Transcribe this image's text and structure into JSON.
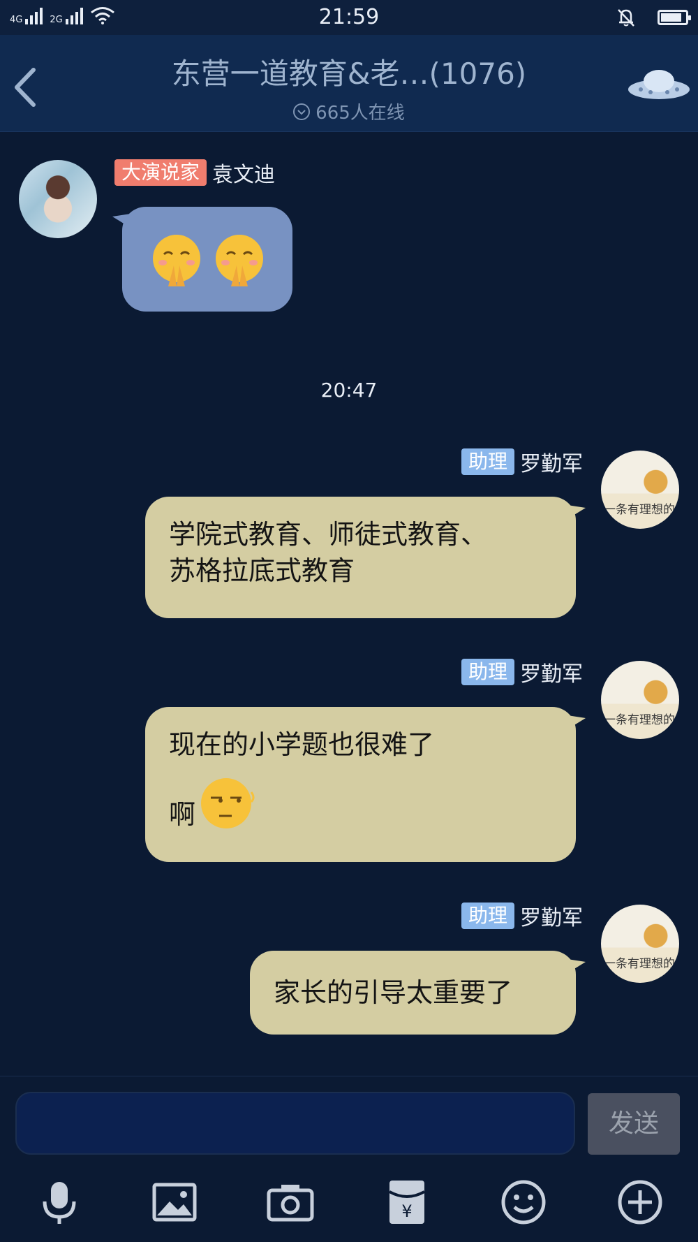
{
  "status_bar": {
    "network_1": "4G",
    "network_2": "2G",
    "time": "21:59",
    "battery_level": 0.85
  },
  "header": {
    "title": "东营一道教育&老…(1076)",
    "online": "665人在线"
  },
  "messages": [
    {
      "direction": "incoming",
      "badge": "大演说家",
      "name": "袁文迪",
      "emoji": [
        "pray-emoji",
        "pray-emoji"
      ]
    },
    {
      "direction": "outgoing",
      "badge": "助理",
      "name": "罗勤军",
      "line1": "学院式教育、师徒式教育、",
      "line2": "苏格拉底式教育"
    },
    {
      "direction": "outgoing",
      "badge": "助理",
      "name": "罗勤军",
      "line1": "现在的小学题也很难了",
      "line2": "啊",
      "emoji": [
        "smirk-emoji"
      ]
    },
    {
      "direction": "outgoing",
      "badge": "助理",
      "name": "罗勤军",
      "text": "家长的引导太重要了"
    }
  ],
  "timestamp": "20:47",
  "avatar_cat_text": "一条有理想的咸鱼",
  "composer": {
    "placeholder": "",
    "send_label": "发送"
  },
  "toolbar": {
    "icons": [
      "microphone-icon",
      "image-icon",
      "camera-icon",
      "red-envelope-icon",
      "emoji-icon",
      "plus-icon"
    ]
  },
  "colors": {
    "background": "#0b1a33",
    "incoming_bubble": "#7892c2",
    "outgoing_bubble": "#d4cda2",
    "badge_red": "#f07d6e",
    "badge_blue": "#8ab7ec"
  }
}
